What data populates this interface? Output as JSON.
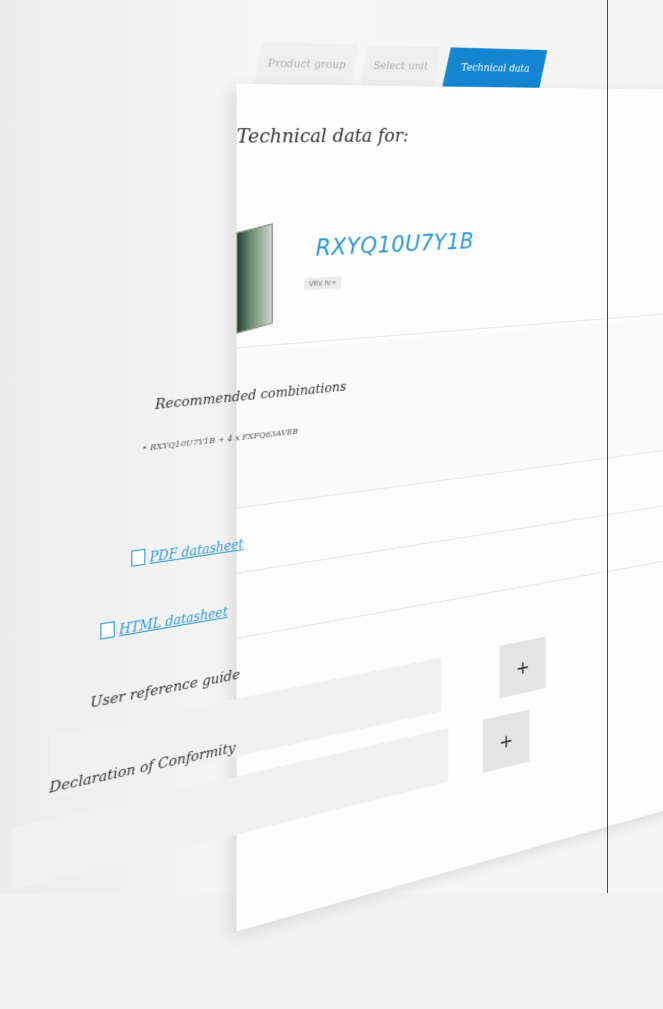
{
  "tabs": [
    {
      "label": "Product group",
      "active": false
    },
    {
      "label": "Select unit",
      "active": false
    },
    {
      "label": "Technical data",
      "active": true
    }
  ],
  "header": {
    "title": "Technical data for:"
  },
  "product": {
    "name": "RXYQ10U7Y1B",
    "tag": "VRV IV+",
    "image_icon": "outdoor-unit-icon"
  },
  "recommended": {
    "title": "Recommended combinations",
    "items": [
      "RXYQ10U7Y1B + 4 x FXFQ63AVEB"
    ]
  },
  "links": [
    {
      "label": "PDF datasheet",
      "icon": "document-icon"
    },
    {
      "label": "HTML datasheet",
      "icon": "document-icon"
    }
  ],
  "accordions": [
    {
      "label": "User reference guide",
      "toggle": "+"
    },
    {
      "label": "Declaration of Conformity",
      "toggle": "+"
    }
  ],
  "colors": {
    "accent": "#1486d1",
    "link": "#2c97d8",
    "guide_line": "#c8007a"
  }
}
